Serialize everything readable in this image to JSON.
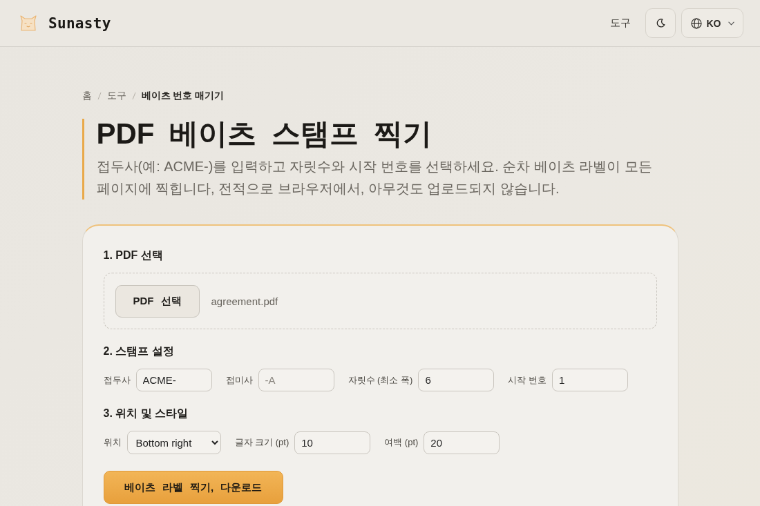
{
  "header": {
    "brand": "Sunasty",
    "nav_link": "도구",
    "language": "KO"
  },
  "breadcrumb": [
    {
      "label": "홈",
      "current": false
    },
    {
      "label": "도구",
      "current": false
    },
    {
      "label": "베이츠 번호 매기기",
      "current": true
    }
  ],
  "title": "PDF 베이츠 스탬프 찍기",
  "description": "접두사(예: ACME-)를 입력하고 자릿수와 시작 번호를 선택하세요. 순차 베이츠 라벨이 모든 페이지에 찍힙니다, 전적으로 브라우저에서, 아무것도 업로드되지 않습니다.",
  "steps": [
    {
      "kind": "file",
      "heading": "1. PDF 선택",
      "button": "PDF 선택",
      "file_name": "agreement.pdf"
    },
    {
      "kind": "fields",
      "heading": "2. 스탬프 설정",
      "fields": [
        {
          "kind": "text",
          "label": "접두사",
          "value": "ACME-"
        },
        {
          "kind": "text",
          "label": "접미사",
          "placeholder": "-A"
        },
        {
          "kind": "text",
          "label": "자릿수 (최소 폭)",
          "value": "6"
        },
        {
          "kind": "text",
          "label": "시작 번호",
          "value": "1"
        }
      ]
    },
    {
      "kind": "fields",
      "heading": "3. 위치 및 스타일",
      "fields": [
        {
          "kind": "select",
          "label": "위치",
          "value": "Bottom right"
        },
        {
          "kind": "text",
          "label": "글자 크기 (pt)",
          "value": "10"
        },
        {
          "kind": "text",
          "label": "여백 (pt)",
          "value": "20"
        }
      ]
    }
  ],
  "primary_button": "베이츠 라벨 찍기, 다운로드"
}
